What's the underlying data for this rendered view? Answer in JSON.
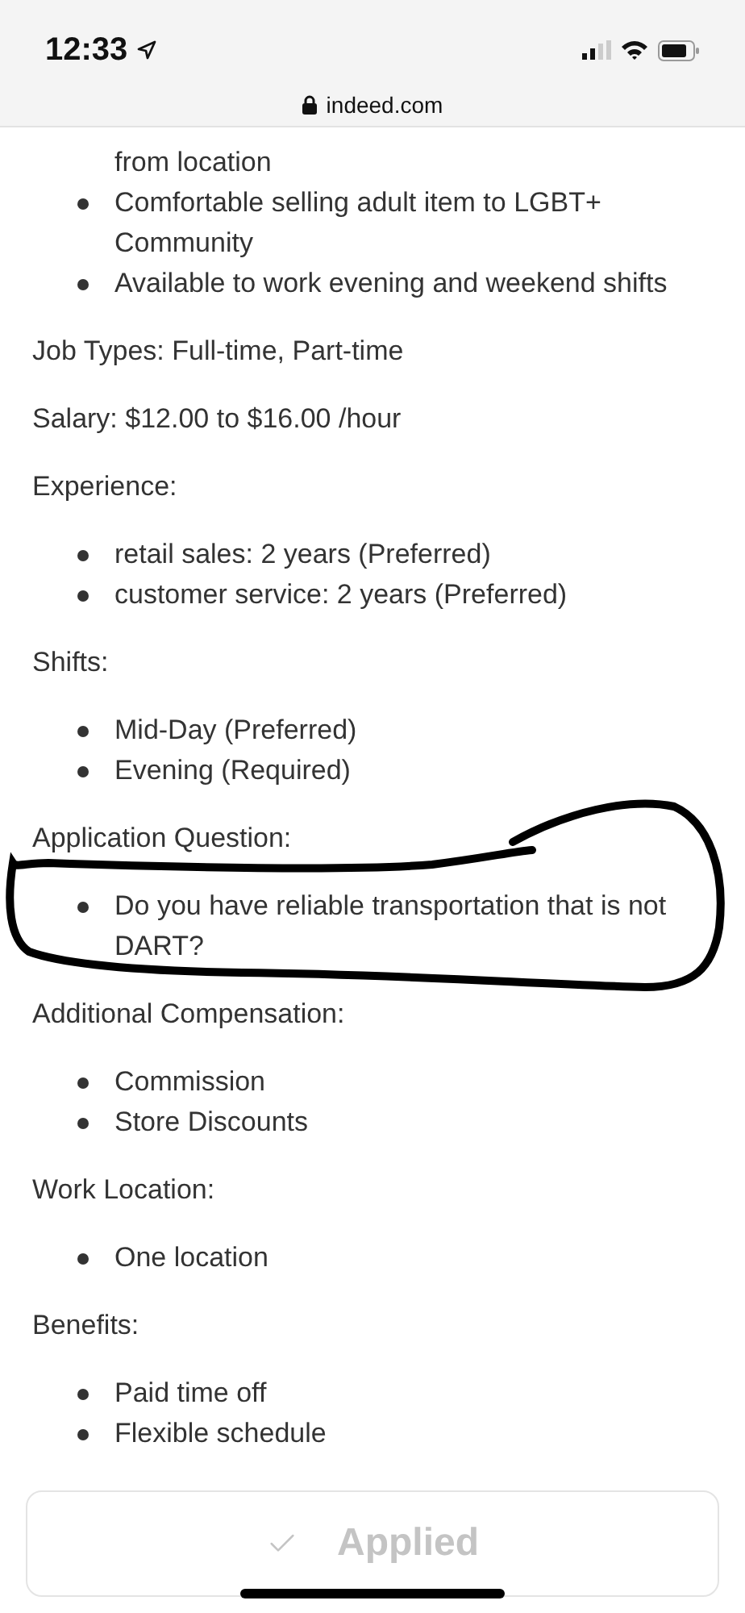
{
  "status_bar": {
    "time": "12:33"
  },
  "address_bar": {
    "url": "indeed.com"
  },
  "sections": [
    {
      "continued": "from location",
      "items": [
        "Comfortable selling adult item to LGBT+ Community",
        "Available to work evening and weekend shifts"
      ]
    },
    {
      "heading": "Job Types: Full-time, Part-time"
    },
    {
      "heading": "Salary: $12.00 to $16.00 /hour"
    },
    {
      "heading": "Experience:",
      "items": [
        "retail sales: 2 years (Preferred)",
        "customer service: 2 years (Preferred)"
      ]
    },
    {
      "heading": "Shifts:",
      "items": [
        "Mid-Day (Preferred)",
        "Evening (Required)"
      ]
    },
    {
      "heading": "Application Question:",
      "items": [
        "Do you have reliable transportation that is not DART?"
      ]
    },
    {
      "heading": "Additional Compensation:",
      "items": [
        "Commission",
        "Store Discounts"
      ]
    },
    {
      "heading": "Work Location:",
      "items": [
        "One location"
      ]
    },
    {
      "heading": "Benefits:",
      "items": [
        "Paid time off",
        "Flexible schedule"
      ]
    }
  ],
  "applied_button": {
    "label": "Applied"
  }
}
